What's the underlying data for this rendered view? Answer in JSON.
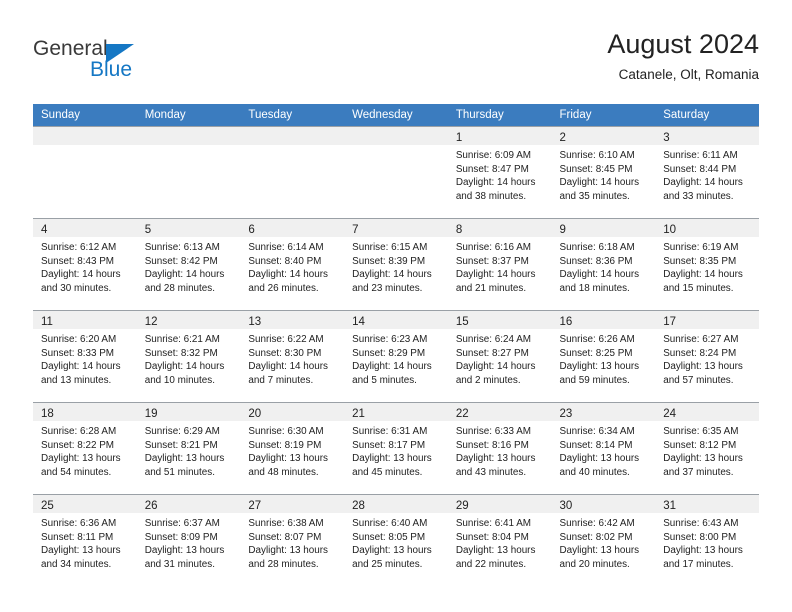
{
  "brand": {
    "name_top": "General",
    "name_bottom": "Blue",
    "triangle_color": "#1577c4"
  },
  "header": {
    "title": "August 2024",
    "subtitle": "Catanele, Olt, Romania"
  },
  "theme": {
    "header_row_bg": "#3b7cbf",
    "daynum_band_bg": "#f0f0f0",
    "row_separator": "#9aa0a6",
    "text": "#222222"
  },
  "weekdays": [
    "Sunday",
    "Monday",
    "Tuesday",
    "Wednesday",
    "Thursday",
    "Friday",
    "Saturday"
  ],
  "labels": {
    "sunrise_prefix": "Sunrise:",
    "sunset_prefix": "Sunset:",
    "daylight_prefix": "Daylight:"
  },
  "weeks": [
    [
      {
        "blank": true
      },
      {
        "blank": true
      },
      {
        "blank": true
      },
      {
        "blank": true
      },
      {
        "day": "1",
        "sunrise": "Sunrise: 6:09 AM",
        "sunset": "Sunset: 8:47 PM",
        "daylight1": "Daylight: 14 hours",
        "daylight2": "and 38 minutes."
      },
      {
        "day": "2",
        "sunrise": "Sunrise: 6:10 AM",
        "sunset": "Sunset: 8:45 PM",
        "daylight1": "Daylight: 14 hours",
        "daylight2": "and 35 minutes."
      },
      {
        "day": "3",
        "sunrise": "Sunrise: 6:11 AM",
        "sunset": "Sunset: 8:44 PM",
        "daylight1": "Daylight: 14 hours",
        "daylight2": "and 33 minutes."
      }
    ],
    [
      {
        "day": "4",
        "sunrise": "Sunrise: 6:12 AM",
        "sunset": "Sunset: 8:43 PM",
        "daylight1": "Daylight: 14 hours",
        "daylight2": "and 30 minutes."
      },
      {
        "day": "5",
        "sunrise": "Sunrise: 6:13 AM",
        "sunset": "Sunset: 8:42 PM",
        "daylight1": "Daylight: 14 hours",
        "daylight2": "and 28 minutes."
      },
      {
        "day": "6",
        "sunrise": "Sunrise: 6:14 AM",
        "sunset": "Sunset: 8:40 PM",
        "daylight1": "Daylight: 14 hours",
        "daylight2": "and 26 minutes."
      },
      {
        "day": "7",
        "sunrise": "Sunrise: 6:15 AM",
        "sunset": "Sunset: 8:39 PM",
        "daylight1": "Daylight: 14 hours",
        "daylight2": "and 23 minutes."
      },
      {
        "day": "8",
        "sunrise": "Sunrise: 6:16 AM",
        "sunset": "Sunset: 8:37 PM",
        "daylight1": "Daylight: 14 hours",
        "daylight2": "and 21 minutes."
      },
      {
        "day": "9",
        "sunrise": "Sunrise: 6:18 AM",
        "sunset": "Sunset: 8:36 PM",
        "daylight1": "Daylight: 14 hours",
        "daylight2": "and 18 minutes."
      },
      {
        "day": "10",
        "sunrise": "Sunrise: 6:19 AM",
        "sunset": "Sunset: 8:35 PM",
        "daylight1": "Daylight: 14 hours",
        "daylight2": "and 15 minutes."
      }
    ],
    [
      {
        "day": "11",
        "sunrise": "Sunrise: 6:20 AM",
        "sunset": "Sunset: 8:33 PM",
        "daylight1": "Daylight: 14 hours",
        "daylight2": "and 13 minutes."
      },
      {
        "day": "12",
        "sunrise": "Sunrise: 6:21 AM",
        "sunset": "Sunset: 8:32 PM",
        "daylight1": "Daylight: 14 hours",
        "daylight2": "and 10 minutes."
      },
      {
        "day": "13",
        "sunrise": "Sunrise: 6:22 AM",
        "sunset": "Sunset: 8:30 PM",
        "daylight1": "Daylight: 14 hours",
        "daylight2": "and 7 minutes."
      },
      {
        "day": "14",
        "sunrise": "Sunrise: 6:23 AM",
        "sunset": "Sunset: 8:29 PM",
        "daylight1": "Daylight: 14 hours",
        "daylight2": "and 5 minutes."
      },
      {
        "day": "15",
        "sunrise": "Sunrise: 6:24 AM",
        "sunset": "Sunset: 8:27 PM",
        "daylight1": "Daylight: 14 hours",
        "daylight2": "and 2 minutes."
      },
      {
        "day": "16",
        "sunrise": "Sunrise: 6:26 AM",
        "sunset": "Sunset: 8:25 PM",
        "daylight1": "Daylight: 13 hours",
        "daylight2": "and 59 minutes."
      },
      {
        "day": "17",
        "sunrise": "Sunrise: 6:27 AM",
        "sunset": "Sunset: 8:24 PM",
        "daylight1": "Daylight: 13 hours",
        "daylight2": "and 57 minutes."
      }
    ],
    [
      {
        "day": "18",
        "sunrise": "Sunrise: 6:28 AM",
        "sunset": "Sunset: 8:22 PM",
        "daylight1": "Daylight: 13 hours",
        "daylight2": "and 54 minutes."
      },
      {
        "day": "19",
        "sunrise": "Sunrise: 6:29 AM",
        "sunset": "Sunset: 8:21 PM",
        "daylight1": "Daylight: 13 hours",
        "daylight2": "and 51 minutes."
      },
      {
        "day": "20",
        "sunrise": "Sunrise: 6:30 AM",
        "sunset": "Sunset: 8:19 PM",
        "daylight1": "Daylight: 13 hours",
        "daylight2": "and 48 minutes."
      },
      {
        "day": "21",
        "sunrise": "Sunrise: 6:31 AM",
        "sunset": "Sunset: 8:17 PM",
        "daylight1": "Daylight: 13 hours",
        "daylight2": "and 45 minutes."
      },
      {
        "day": "22",
        "sunrise": "Sunrise: 6:33 AM",
        "sunset": "Sunset: 8:16 PM",
        "daylight1": "Daylight: 13 hours",
        "daylight2": "and 43 minutes."
      },
      {
        "day": "23",
        "sunrise": "Sunrise: 6:34 AM",
        "sunset": "Sunset: 8:14 PM",
        "daylight1": "Daylight: 13 hours",
        "daylight2": "and 40 minutes."
      },
      {
        "day": "24",
        "sunrise": "Sunrise: 6:35 AM",
        "sunset": "Sunset: 8:12 PM",
        "daylight1": "Daylight: 13 hours",
        "daylight2": "and 37 minutes."
      }
    ],
    [
      {
        "day": "25",
        "sunrise": "Sunrise: 6:36 AM",
        "sunset": "Sunset: 8:11 PM",
        "daylight1": "Daylight: 13 hours",
        "daylight2": "and 34 minutes."
      },
      {
        "day": "26",
        "sunrise": "Sunrise: 6:37 AM",
        "sunset": "Sunset: 8:09 PM",
        "daylight1": "Daylight: 13 hours",
        "daylight2": "and 31 minutes."
      },
      {
        "day": "27",
        "sunrise": "Sunrise: 6:38 AM",
        "sunset": "Sunset: 8:07 PM",
        "daylight1": "Daylight: 13 hours",
        "daylight2": "and 28 minutes."
      },
      {
        "day": "28",
        "sunrise": "Sunrise: 6:40 AM",
        "sunset": "Sunset: 8:05 PM",
        "daylight1": "Daylight: 13 hours",
        "daylight2": "and 25 minutes."
      },
      {
        "day": "29",
        "sunrise": "Sunrise: 6:41 AM",
        "sunset": "Sunset: 8:04 PM",
        "daylight1": "Daylight: 13 hours",
        "daylight2": "and 22 minutes."
      },
      {
        "day": "30",
        "sunrise": "Sunrise: 6:42 AM",
        "sunset": "Sunset: 8:02 PM",
        "daylight1": "Daylight: 13 hours",
        "daylight2": "and 20 minutes."
      },
      {
        "day": "31",
        "sunrise": "Sunrise: 6:43 AM",
        "sunset": "Sunset: 8:00 PM",
        "daylight1": "Daylight: 13 hours",
        "daylight2": "and 17 minutes."
      }
    ]
  ]
}
